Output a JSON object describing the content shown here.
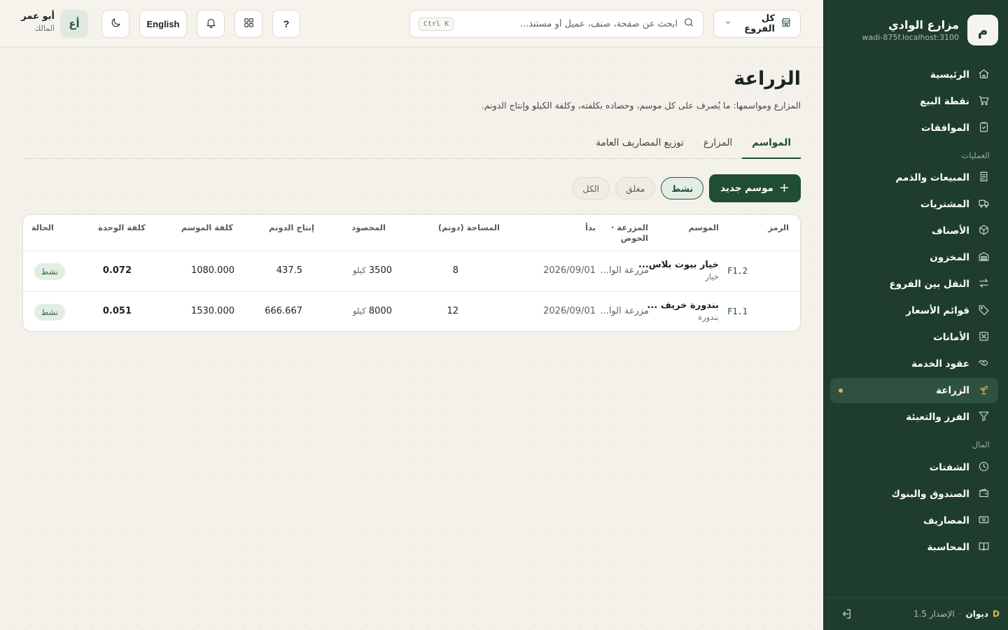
{
  "brand": {
    "logo_letter": "م",
    "name": "مزارع الوادي",
    "domain": "wadi-875f.localhost:3100"
  },
  "sidebar": {
    "items": [
      {
        "label": "الرئيسية",
        "icon": "home-icon"
      },
      {
        "label": "نقطة البيع",
        "icon": "cart-icon"
      },
      {
        "label": "الموافقات",
        "icon": "clipboard-check-icon"
      },
      {
        "label": "المبيعات والذمم",
        "icon": "receipt-icon"
      },
      {
        "label": "المشتريات",
        "icon": "truck-icon"
      },
      {
        "label": "الأصناف",
        "icon": "box-icon"
      },
      {
        "label": "المخزون",
        "icon": "warehouse-icon"
      },
      {
        "label": "النقل بين الفروع",
        "icon": "transfer-icon"
      },
      {
        "label": "قوائم الأسعار",
        "icon": "tag-icon"
      },
      {
        "label": "الأمانات",
        "icon": "consignment-icon"
      },
      {
        "label": "عقود الخدمة",
        "icon": "handshake-icon"
      },
      {
        "label": "الزراعة",
        "icon": "sprout-icon",
        "active": true
      },
      {
        "label": "الفرز والتعبئة",
        "icon": "filter-icon"
      },
      {
        "label": "الشفتات",
        "icon": "clock-icon"
      },
      {
        "label": "الصندوق والبنوك",
        "icon": "wallet-icon"
      },
      {
        "label": "المصاريف",
        "icon": "banknote-icon"
      },
      {
        "label": "المحاسبة",
        "icon": "book-icon"
      }
    ],
    "sections": {
      "operations": "العمليات",
      "finance": "المال"
    },
    "footer": {
      "logo": "D",
      "app_name": "ديوان",
      "separator": "·",
      "version": "الإصدار 1.5"
    }
  },
  "topbar": {
    "branch_label": "كل الفروع",
    "search_placeholder": "ابحث عن صفحة، صنف، عميل أو مستند...",
    "search_shortcut": "Ctrl K",
    "help_label": "?",
    "language_label": "English",
    "user": {
      "initials": "أع",
      "name": "أبو عمر",
      "role": "المالك"
    }
  },
  "page": {
    "title": "الزراعة",
    "subtitle": "المزارع ومواسمها: ما يُصرف على كل موسم، وحصاده بكلفته، وكلفة الكيلو وإنتاج الدونم.",
    "tabs": [
      "المواسم",
      "المزارع",
      "توزيع المصاريف العامة"
    ],
    "new_button": "موسم جديد",
    "filters": [
      "نشط",
      "مغلق",
      "الكل"
    ]
  },
  "table": {
    "headers": {
      "code": "الرمز",
      "season": "الموسم",
      "farm_line1": "المزرعة ·",
      "farm_line2": "الحوض",
      "started": "بدأ",
      "area": "المساحة (دونم)",
      "harvest": "المحصود",
      "yield": "إنتاج الدونم",
      "season_cost": "كلفة الموسم",
      "unit_cost": "كلفة الوحدة",
      "status": "الحالة"
    },
    "rows": [
      {
        "code": "F1.2",
        "season": "خيار بيوت بلاس...",
        "crop": "خيار",
        "farm": "مزرعة الوا...",
        "started": "2026/09/01",
        "area": "8",
        "harvest_qty": "3500",
        "harvest_unit": "كيلو",
        "yield": "437.5",
        "season_cost": "1080.000",
        "unit_cost": "0.072",
        "status": "نشط"
      },
      {
        "code": "F1.1",
        "season": "بندورة خريف ...",
        "crop": "بندورة",
        "farm": "مزرعة الوا...",
        "started": "2026/09/01",
        "area": "12",
        "harvest_qty": "8000",
        "harvest_unit": "كيلو",
        "yield": "666.667",
        "season_cost": "1530.000",
        "unit_cost": "0.051",
        "status": "نشط"
      }
    ]
  }
}
